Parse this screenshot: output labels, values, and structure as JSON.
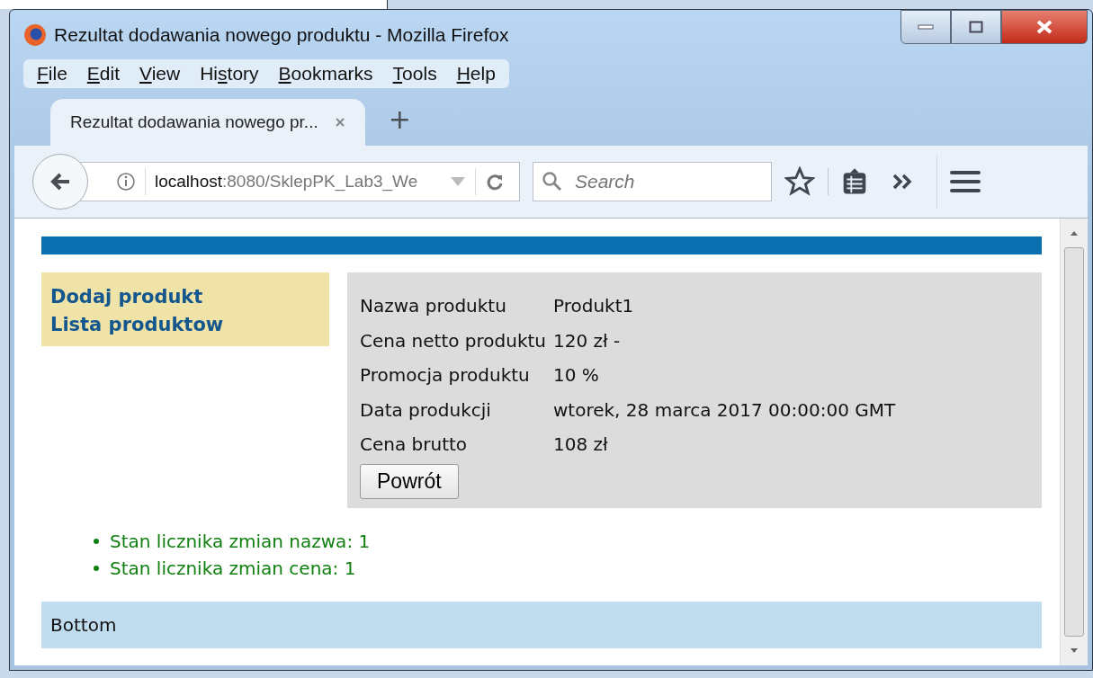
{
  "window": {
    "title": "Rezultat dodawania nowego produktu - Mozilla Firefox"
  },
  "menu": [
    {
      "key": "F",
      "after": "ile"
    },
    {
      "key": "E",
      "after": "dit"
    },
    {
      "key": "V",
      "after": "iew"
    },
    {
      "before": "Hi",
      "key": "s",
      "after": "tory"
    },
    {
      "key": "B",
      "after": "ookmarks"
    },
    {
      "key": "T",
      "after": "ools"
    },
    {
      "key": "H",
      "after": "elp"
    }
  ],
  "tabs": [
    {
      "label": "Rezultat dodawania nowego pr...",
      "selected": true
    }
  ],
  "new_tab": "+",
  "address_bar": {
    "host": "localhost",
    "path": ":8080/SklepPK_Lab3_We"
  },
  "search": {
    "placeholder": "Search"
  },
  "sidebar": {
    "links": [
      "Dodaj produkt",
      "Lista produktow"
    ]
  },
  "details": [
    {
      "label": "Nazwa produktu",
      "value": "Produkt1"
    },
    {
      "label": "Cena netto produktu",
      "value": "120 zł -"
    },
    {
      "label": "Promocja produktu",
      "value": "10 %"
    },
    {
      "label": "Data produkcji",
      "value": "wtorek, 28 marca 2017 00:00:00 GMT"
    },
    {
      "label": "Cena brutto",
      "value": "108 zł"
    }
  ],
  "back_button": "Powrót",
  "counters": [
    "Stan licznika zmian nazwa: 1",
    "Stan licznika zmian cena: 1"
  ],
  "footer": "Bottom"
}
